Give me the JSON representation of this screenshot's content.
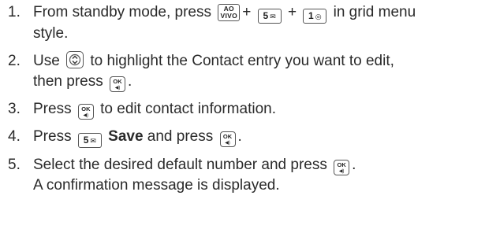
{
  "steps": [
    {
      "number": "1.",
      "parts": {
        "a": "From standby mode, press",
        "plus1": "+",
        "plus2": "+",
        "b": "in grid menu",
        "c": "style."
      },
      "keys": {
        "aovivo": {
          "top": "AO",
          "bottom": "VIVO",
          "icon": "ao-vivo-key-icon"
        },
        "key5": {
          "digit": "5",
          "glyph": "✉",
          "icon": "five-key-icon"
        },
        "key1": {
          "digit": "1",
          "glyph": "◎",
          "icon": "one-key-icon"
        }
      }
    },
    {
      "number": "2.",
      "parts": {
        "a": "Use",
        "b": "to highlight the Contact entry you want to edit,",
        "c": "then press",
        "d": "."
      },
      "keys": {
        "nav": {
          "icon": "navigation-key-icon"
        },
        "ok": {
          "label": "OK",
          "sub": "◀)",
          "icon": "ok-key-icon"
        }
      }
    },
    {
      "number": "3.",
      "parts": {
        "a": "Press",
        "b": "to edit contact information."
      },
      "keys": {
        "ok": {
          "label": "OK",
          "sub": "◀)",
          "icon": "ok-key-icon"
        }
      }
    },
    {
      "number": "4.",
      "parts": {
        "a": "Press",
        "bold": "Save",
        "b": "and press",
        "c": "."
      },
      "keys": {
        "key5": {
          "digit": "5",
          "glyph": "✉",
          "icon": "five-key-icon"
        },
        "ok": {
          "label": "OK",
          "sub": "◀)",
          "icon": "ok-key-icon"
        }
      }
    },
    {
      "number": "5.",
      "parts": {
        "a": "Select the desired default number and press",
        "b": ".",
        "c": "A confirmation message is displayed."
      },
      "keys": {
        "ok": {
          "label": "OK",
          "sub": "◀)",
          "icon": "ok-key-icon"
        }
      }
    }
  ]
}
